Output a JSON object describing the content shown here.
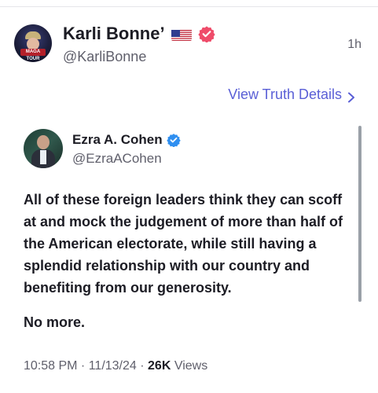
{
  "post": {
    "author_name": "Karli Bonne’",
    "author_handle": "@KarliBonne",
    "time": "1h",
    "avatar_text": "MAGA TOUR",
    "flag_icon": "us-flag-icon",
    "verified_color": "#ef4c6a"
  },
  "view_details": {
    "label": "View Truth Details",
    "chevron": ">"
  },
  "quoted": {
    "author_name": "Ezra A. Cohen",
    "author_handle": "@EzraACohen",
    "verified_color": "#2f8ff0",
    "body": "All of these foreign leaders think they can scoff at and mock the judgement of more than half of the American electorate, while still having a splendid relationship with our country and benefiting from our generosity.",
    "closing": "No more.",
    "timestamp": "10:58 PM · 11/13/24 · ",
    "views_count": "26K",
    "views_label": " Views"
  }
}
